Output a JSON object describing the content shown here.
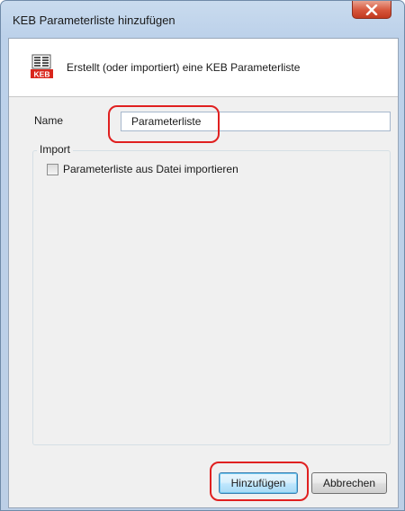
{
  "window": {
    "title": "KEB Parameterliste hinzufügen",
    "close_icon": "close-icon"
  },
  "header": {
    "icon": "keb-logo-icon",
    "icon_text": "KEB",
    "description": "Erstellt (oder importiert) eine KEB Parameterliste"
  },
  "form": {
    "name_label": "Name",
    "name_value": "Parameterliste",
    "import_group_label": "Import",
    "import_checkbox_label": "Parameterliste aus Datei importieren",
    "import_checkbox_checked": false
  },
  "buttons": {
    "add_label": "Hinzufügen",
    "cancel_label": "Abbrechen"
  },
  "colors": {
    "highlight": "#e02020",
    "keb_brand": "#d9261c",
    "close_button": "#c94a2f"
  }
}
